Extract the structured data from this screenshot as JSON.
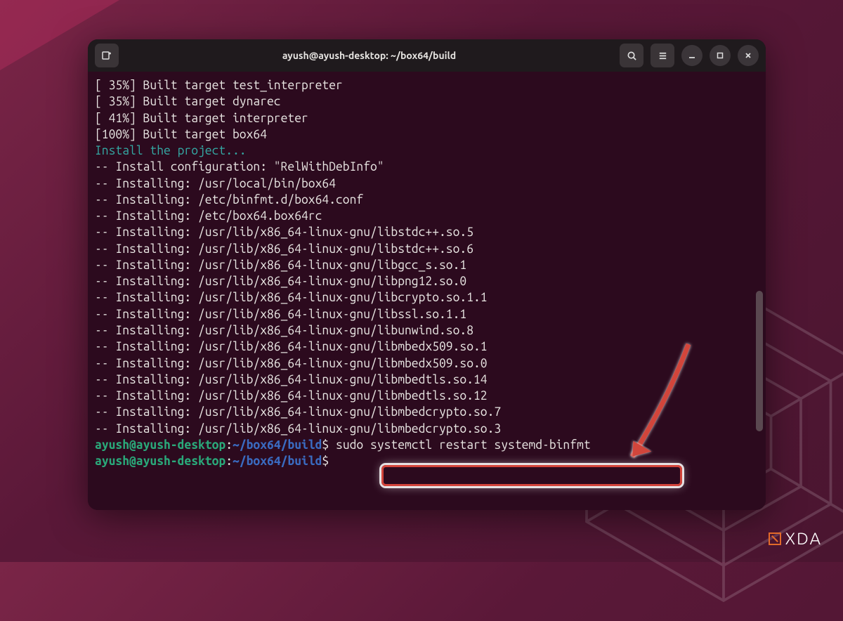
{
  "titlebar": {
    "title": "ayush@ayush-desktop: ~/box64/build"
  },
  "terminal": {
    "lines": [
      {
        "text": "[ 35%] Built target test_interpreter",
        "cls": "white"
      },
      {
        "text": "[ 35%] Built target dynarec",
        "cls": "white"
      },
      {
        "text": "[ 41%] Built target interpreter",
        "cls": "white"
      },
      {
        "text": "[100%] Built target box64",
        "cls": "white"
      },
      {
        "text": "Install the project...",
        "cls": "cyan"
      },
      {
        "text": "-- Install configuration: \"RelWithDebInfo\"",
        "cls": "white"
      },
      {
        "text": "-- Installing: /usr/local/bin/box64",
        "cls": "white"
      },
      {
        "text": "-- Installing: /etc/binfmt.d/box64.conf",
        "cls": "white"
      },
      {
        "text": "-- Installing: /etc/box64.box64rc",
        "cls": "white"
      },
      {
        "text": "-- Installing: /usr/lib/x86_64-linux-gnu/libstdc++.so.5",
        "cls": "white"
      },
      {
        "text": "-- Installing: /usr/lib/x86_64-linux-gnu/libstdc++.so.6",
        "cls": "white"
      },
      {
        "text": "-- Installing: /usr/lib/x86_64-linux-gnu/libgcc_s.so.1",
        "cls": "white"
      },
      {
        "text": "-- Installing: /usr/lib/x86_64-linux-gnu/libpng12.so.0",
        "cls": "white"
      },
      {
        "text": "-- Installing: /usr/lib/x86_64-linux-gnu/libcrypto.so.1.1",
        "cls": "white"
      },
      {
        "text": "-- Installing: /usr/lib/x86_64-linux-gnu/libssl.so.1.1",
        "cls": "white"
      },
      {
        "text": "-- Installing: /usr/lib/x86_64-linux-gnu/libunwind.so.8",
        "cls": "white"
      },
      {
        "text": "-- Installing: /usr/lib/x86_64-linux-gnu/libmbedx509.so.1",
        "cls": "white"
      },
      {
        "text": "-- Installing: /usr/lib/x86_64-linux-gnu/libmbedx509.so.0",
        "cls": "white"
      },
      {
        "text": "-- Installing: /usr/lib/x86_64-linux-gnu/libmbedtls.so.14",
        "cls": "white"
      },
      {
        "text": "-- Installing: /usr/lib/x86_64-linux-gnu/libmbedtls.so.12",
        "cls": "white"
      },
      {
        "text": "-- Installing: /usr/lib/x86_64-linux-gnu/libmbedcrypto.so.7",
        "cls": "white"
      },
      {
        "text": "-- Installing: /usr/lib/x86_64-linux-gnu/libmbedcrypto.so.3",
        "cls": "white"
      }
    ],
    "prompts": [
      {
        "user": "ayush@ayush-desktop",
        "sep": ":",
        "path": "~/box64/build",
        "sym": "$",
        "cmd": " sudo systemctl restart systemd-binfmt"
      },
      {
        "user": "ayush@ayush-desktop",
        "sep": ":",
        "path": "~/box64/build",
        "sym": "$",
        "cmd": ""
      }
    ]
  },
  "annotation": {
    "highlighted_command": "sudo systemctl restart systemd-binfmt"
  },
  "branding": {
    "logo": "XDA"
  }
}
